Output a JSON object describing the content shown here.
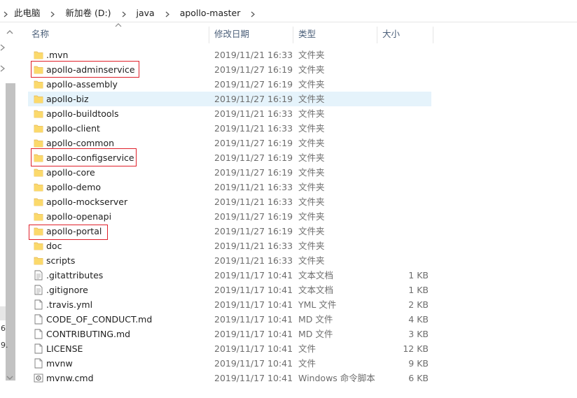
{
  "breadcrumb": [
    "此电脑",
    "新加卷 (D:)",
    "java",
    "apollo-master"
  ],
  "columns": {
    "name": "名称",
    "date": "修改日期",
    "type": "类型",
    "size": "大小"
  },
  "files": [
    {
      "name": ".mvn",
      "date": "2019/11/21 16:33",
      "type": "文件夹",
      "size": "",
      "icon": "folder-icon"
    },
    {
      "name": "apollo-adminservice",
      "date": "2019/11/27 16:19",
      "type": "文件夹",
      "size": "",
      "icon": "folder-icon"
    },
    {
      "name": "apollo-assembly",
      "date": "2019/11/27 16:19",
      "type": "文件夹",
      "size": "",
      "icon": "folder-icon"
    },
    {
      "name": "apollo-biz",
      "date": "2019/11/27 16:19",
      "type": "文件夹",
      "size": "",
      "icon": "folder-icon"
    },
    {
      "name": "apollo-buildtools",
      "date": "2019/11/21 16:33",
      "type": "文件夹",
      "size": "",
      "icon": "folder-icon"
    },
    {
      "name": "apollo-client",
      "date": "2019/11/21 16:33",
      "type": "文件夹",
      "size": "",
      "icon": "folder-icon"
    },
    {
      "name": "apollo-common",
      "date": "2019/11/27 16:19",
      "type": "文件夹",
      "size": "",
      "icon": "folder-icon"
    },
    {
      "name": "apollo-configservice",
      "date": "2019/11/27 16:19",
      "type": "文件夹",
      "size": "",
      "icon": "folder-icon"
    },
    {
      "name": "apollo-core",
      "date": "2019/11/27 16:19",
      "type": "文件夹",
      "size": "",
      "icon": "folder-icon"
    },
    {
      "name": "apollo-demo",
      "date": "2019/11/21 16:33",
      "type": "文件夹",
      "size": "",
      "icon": "folder-icon"
    },
    {
      "name": "apollo-mockserver",
      "date": "2019/11/21 16:33",
      "type": "文件夹",
      "size": "",
      "icon": "folder-icon"
    },
    {
      "name": "apollo-openapi",
      "date": "2019/11/27 16:19",
      "type": "文件夹",
      "size": "",
      "icon": "folder-icon"
    },
    {
      "name": "apollo-portal",
      "date": "2019/11/27 16:19",
      "type": "文件夹",
      "size": "",
      "icon": "folder-icon"
    },
    {
      "name": "doc",
      "date": "2019/11/21 16:33",
      "type": "文件夹",
      "size": "",
      "icon": "folder-icon"
    },
    {
      "name": "scripts",
      "date": "2019/11/21 16:33",
      "type": "文件夹",
      "size": "",
      "icon": "folder-icon"
    },
    {
      "name": ".gitattributes",
      "date": "2019/11/17 10:41",
      "type": "文本文档",
      "size": "1 KB",
      "icon": "text-file-icon"
    },
    {
      "name": ".gitignore",
      "date": "2019/11/17 10:41",
      "type": "文本文档",
      "size": "1 KB",
      "icon": "text-file-icon"
    },
    {
      "name": ".travis.yml",
      "date": "2019/11/17 10:41",
      "type": "YML 文件",
      "size": "2 KB",
      "icon": "file-icon"
    },
    {
      "name": "CODE_OF_CONDUCT.md",
      "date": "2019/11/17 10:41",
      "type": "MD 文件",
      "size": "4 KB",
      "icon": "file-icon"
    },
    {
      "name": "CONTRIBUTING.md",
      "date": "2019/11/17 10:41",
      "type": "MD 文件",
      "size": "3 KB",
      "icon": "file-icon"
    },
    {
      "name": "LICENSE",
      "date": "2019/11/17 10:41",
      "type": "文件",
      "size": "12 KB",
      "icon": "file-icon"
    },
    {
      "name": "mvnw",
      "date": "2019/11/17 10:41",
      "type": "文件",
      "size": "9 KB",
      "icon": "file-icon"
    },
    {
      "name": "mvnw.cmd",
      "date": "2019/11/17 10:41",
      "type": "Windows 命令脚本",
      "size": "6 KB",
      "icon": "cmd-script-icon"
    }
  ],
  "nav_partial": [
    "6",
    "9."
  ],
  "colors": {
    "folder": "#f8d775",
    "folder_dark": "#e6b94b",
    "highlight_box": "#e0202a",
    "selection": "#e5f3fb",
    "header_text": "#4c607a"
  }
}
